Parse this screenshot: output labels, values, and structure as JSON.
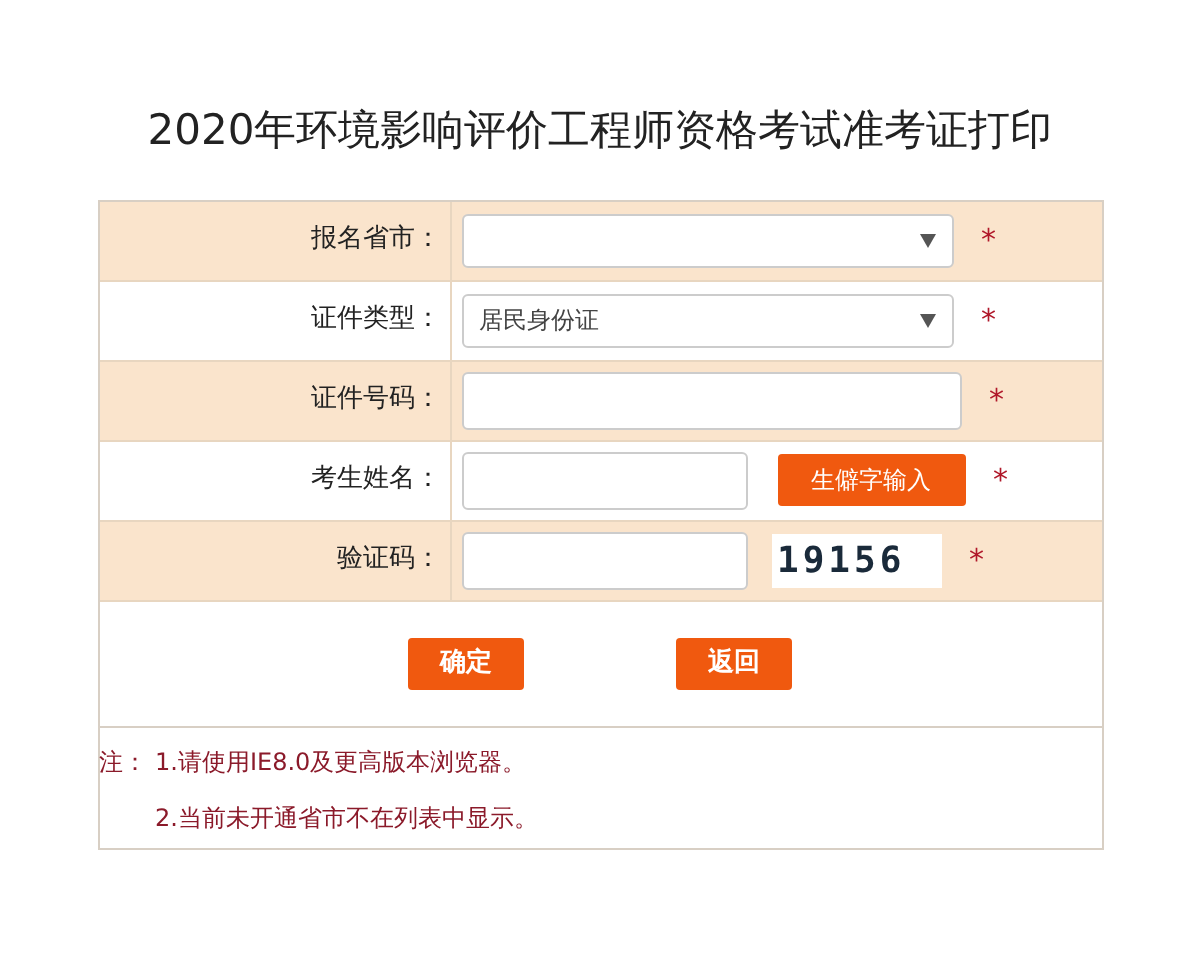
{
  "title": "2020年环境影响评价工程师资格考试准考证打印",
  "rows": [
    {
      "kind": "select",
      "label": "报名省市：",
      "value": "",
      "required": true
    },
    {
      "kind": "select",
      "label": "证件类型：",
      "value": "居民身份证",
      "required": true
    },
    {
      "kind": "input",
      "label": "证件号码：",
      "required": true
    },
    {
      "kind": "input_button",
      "label": "考生姓名：",
      "button": "生僻字输入",
      "required": true
    },
    {
      "kind": "captcha",
      "label": "验证码：",
      "captcha": "19156",
      "required": true
    }
  ],
  "required_mark": "*",
  "buttons": [
    "确定",
    "返回"
  ],
  "notes_label": "注：",
  "notes": [
    "1.请使用IE8.0及更高版本浏览器。",
    "2.当前未开通省市不在列表中显示。"
  ]
}
